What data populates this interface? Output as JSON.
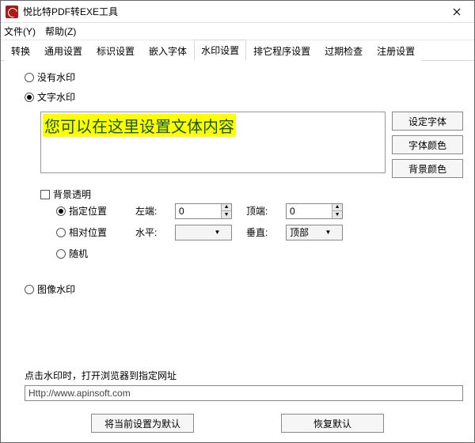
{
  "window": {
    "title": "悦比特PDF转EXE工具"
  },
  "menu": {
    "file": "文件(Y)",
    "help": "帮助(Z)"
  },
  "tabs": [
    "转换",
    "通用设置",
    "标识设置",
    "嵌入字体",
    "水印设置",
    "排它程序设置",
    "过期检查",
    "注册设置"
  ],
  "active_tab": 4,
  "watermark": {
    "none_label": "没有水印",
    "text_label": "文字水印",
    "image_label": "图像水印",
    "selected": "text",
    "preview_text": "您可以在这里设置文体内容",
    "btn_font": "设定字体",
    "btn_font_color": "字体颜色",
    "btn_bg_color": "背景颜色",
    "bg_transparent_label": "背景透明",
    "bg_transparent_checked": false
  },
  "position": {
    "mode": "fixed",
    "fixed_label": "指定位置",
    "relative_label": "相对位置",
    "random_label": "随机",
    "left_label": "左端:",
    "top_label": "顶端:",
    "horiz_label": "水平:",
    "vert_label": "垂直:",
    "left_value": "0",
    "top_value": "0",
    "horiz_value": "",
    "vert_value": "顶部"
  },
  "url": {
    "label": "点击水印时，打开浏览器到指定网址",
    "value": "Http://www.apinsoft.com"
  },
  "buttons": {
    "set_default": "将当前设置为默认",
    "restore_default": "恢复默认"
  }
}
